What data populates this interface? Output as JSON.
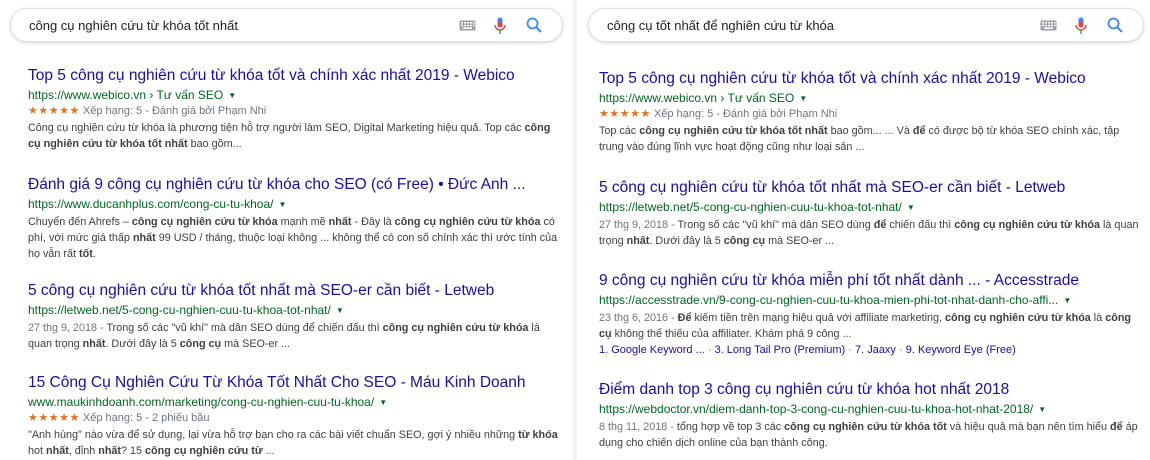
{
  "left": {
    "query": "công cụ nghiên cứu từ khóa tốt nhất",
    "results": [
      {
        "title": "Top 5 công cụ nghiên cứu từ khóa tốt và chính xác nhất 2019 - Webico",
        "url": "https://www.webico.vn › Tư vấn SEO",
        "stars": "★★★★★",
        "rating": "Xếp hạng: 5 - Đánh giá bởi Phạm Nhi",
        "s1": "Công cụ nghiên cứu từ khóa là phương tiện hỗ trợ người làm SEO, Digital Marketing hiệu quả. Top các ",
        "s1b": "công cụ nghiên cứu từ khóa tốt nhất",
        "s1c": " bao gồm..."
      },
      {
        "title": "Đánh giá 9 công cụ nghiên cứu từ khóa cho SEO (có Free) • Đức Anh ...",
        "url": "https://www.ducanhplus.com/cong-cu-tu-khoa/",
        "s1": "Chuyển đến Ahrefs – ",
        "s1b": "công cụ nghiên cứu từ khóa",
        "s1c": " mạnh mẽ ",
        "s1d": "nhất",
        "s1e": " - Đây là ",
        "s1f": "công cụ nghiên cứu từ khóa",
        "s1g": " có phí, với mức giá thấp ",
        "s1h": "nhất",
        "s1i": " 99 USD / tháng, thuộc loại không ... không thể có con số chính xác thì ước tính của họ vẫn rất ",
        "s1j": "tốt",
        "s1k": "."
      },
      {
        "title": "5 công cụ nghiên cứu từ khóa tốt nhất mà SEO-er cần biết - Letweb",
        "url": "https://letweb.net/5-cong-cu-nghien-cuu-tu-khoa-tot-nhat/",
        "date": "27 thg 9, 2018 - ",
        "s1": "Trong số các \"vũ khí\" mà dân SEO dùng để chiến đấu thì ",
        "s1b": "công cụ nghiên cứu từ khóa",
        "s1c": " là quan trọng ",
        "s1d": "nhất",
        "s1e": ". Dưới đây là 5 ",
        "s1f": "công cụ",
        "s1g": " mà SEO-er ..."
      },
      {
        "title": "15 Công Cụ Nghiên Cứu Từ Khóa Tốt Nhất Cho SEO - Máu Kinh Doanh",
        "url": "www.maukinhdoanh.com/marketing/cong-cu-nghien-cuu-tu-khoa/",
        "stars": "★★★★★",
        "rating": "Xếp hạng: 5 - 2 phiếu bầu",
        "s1": "\"Anh hùng\" nào vừa để sử dụng, lại vừa hỗ trợ bạn cho ra các bài viết chuẩn SEO, gợi ý nhiều những ",
        "s1b": "từ khóa",
        "s1c": " hot ",
        "s1d": "nhất",
        "s1e": ", đỉnh ",
        "s1f": "nhất",
        "s1g": "? 15 ",
        "s1h": "công cụ nghiên cứu từ",
        "s1i": " ..."
      }
    ]
  },
  "right": {
    "query": "công cụ tốt nhất để nghiên cứu từ khóa",
    "results": [
      {
        "title": "Top 5 công cụ nghiên cứu từ khóa tốt và chính xác nhất 2019 - Webico",
        "url": "https://www.webico.vn › Tư vấn SEO",
        "stars": "★★★★★",
        "rating": "Xếp hạng: 5 - Đánh giá bởi Phạm Nhi",
        "s1": "Top các ",
        "s1b": "công cụ nghiên cứu từ khóa tốt nhất",
        "s1c": " bao gồm... ... Và ",
        "s1d": "để",
        "s1e": " có được bộ từ khóa SEO chính xác, tập trung vào đúng lĩnh vực hoạt động cũng như loại sản ..."
      },
      {
        "title": "5 công cụ nghiên cứu từ khóa tốt nhất mà SEO-er cần biết - Letweb",
        "url": "https://letweb.net/5-cong-cu-nghien-cuu-tu-khoa-tot-nhat/",
        "date": "27 thg 9, 2018 - ",
        "s1": "Trong số các \"vũ khí\" mà dân SEO dùng ",
        "s1b": "để",
        "s1c": " chiến đấu thì ",
        "s1d": "công cụ nghiên cứu từ khóa",
        "s1e": " là quan trọng ",
        "s1f": "nhất",
        "s1g": ". Dưới đây là 5 ",
        "s1h": "công cụ",
        "s1i": " mà SEO-er ..."
      },
      {
        "title": "9 công cụ nghiên cứu từ khóa miễn phí tốt nhất dành ... - Accesstrade",
        "url": "https://accesstrade.vn/9-cong-cu-nghien-cuu-tu-khoa-mien-phi-tot-nhat-danh-cho-affi...",
        "date": "23 thg 6, 2016 - ",
        "s1b": "Để",
        "s1c": " kiếm tiền trên mạng hiệu quả với affiliate marketing, ",
        "s1d": "công cụ nghiên cứu từ khóa",
        "s1e": " là ",
        "s1f": "công cụ",
        "s1g": " không thể thiếu của affiliater. Khám phá 9 công ...",
        "links": [
          "1. Google Keyword ...",
          "3. Long Tail Pro (Premium)",
          "7. Jaaxy",
          "9. Keyword Eye (Free)"
        ],
        "link_sep": " · "
      },
      {
        "title": "Điểm danh top 3 công cụ nghiên cứu từ khóa hot nhất 2018",
        "url": "https://webdoctor.vn/diem-danh-top-3-cong-cu-nghien-cuu-tu-khoa-hot-nhat-2018/",
        "date": "8 thg 11, 2018 - ",
        "s1": "tổng hợp về top 3 các ",
        "s1b": "công cụ nghiên cứu từ khóa tốt",
        "s1c": " và hiệu quả mà bạn nên tìm hiểu ",
        "s1d": "để",
        "s1e": " áp dụng cho chiến dịch online của bạn thành công."
      }
    ]
  },
  "colors": {
    "title": "#1a0dab",
    "url": "#006621",
    "stars": "#e7711b",
    "mic": "#ea4335",
    "search": "#4285f4"
  },
  "icons": {
    "keyboard": "keyboard-icon",
    "mic": "mic-icon",
    "search": "search-icon",
    "caret": "caret-down-icon"
  }
}
